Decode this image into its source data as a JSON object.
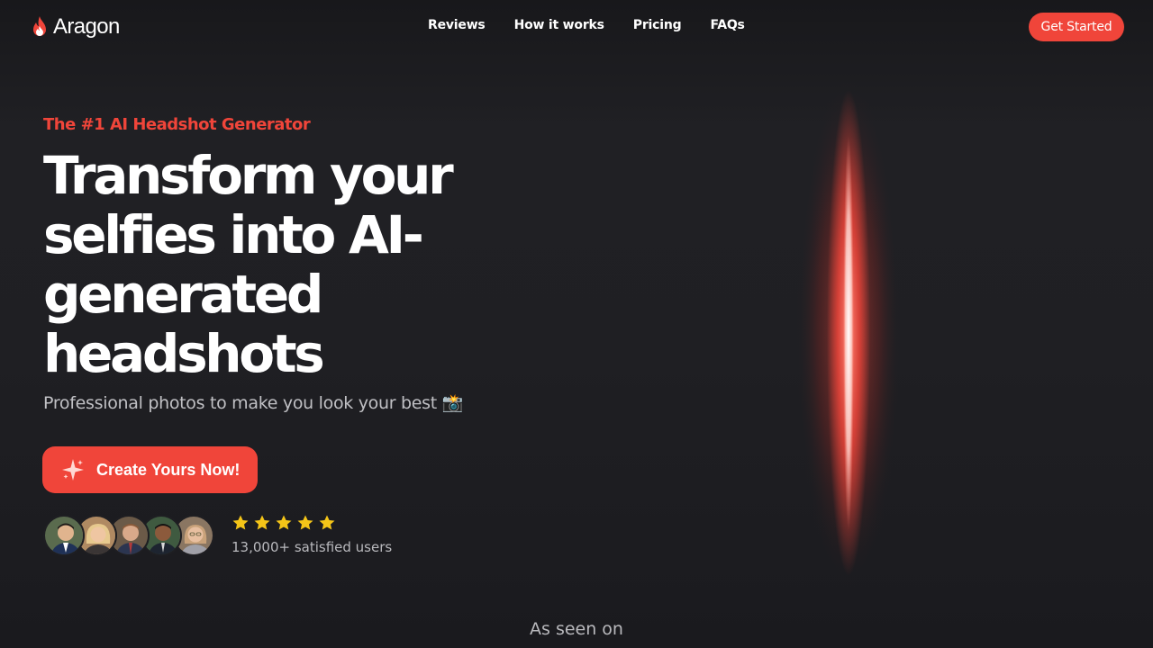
{
  "brand": {
    "name": "Aragon",
    "accent": "#f0453a",
    "logo_icon": "flame-icon"
  },
  "nav": {
    "items": [
      {
        "label": "Reviews"
      },
      {
        "label": "How it works"
      },
      {
        "label": "Pricing"
      },
      {
        "label": "FAQs"
      }
    ],
    "cta_label": "Get Started"
  },
  "hero": {
    "eyebrow": "The #1 AI Headshot Generator",
    "headline": "Transform your selfies into AI-generated headshots",
    "subhead": "Professional photos to make you look your best 📸",
    "cta_label": "Create Yours Now!",
    "cta_icon": "sparkle-icon",
    "rating": {
      "stars": 5,
      "max": 5,
      "text": "13,000+ satisfied users"
    }
  },
  "press": {
    "heading": "As seen on"
  }
}
